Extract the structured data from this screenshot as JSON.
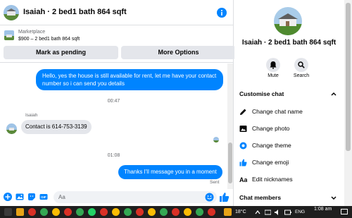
{
  "header": {
    "title": "Isaiah · 2 bed1 bath 864 sqft"
  },
  "listing": {
    "tag": "Marketplace",
    "summary": "$900 – 2 bed1 bath 864 sqft",
    "mark_pending_label": "Mark as pending",
    "more_options_label": "More Options"
  },
  "thread": {
    "messages": [
      {
        "from": "me",
        "text": "Hello, yes the house is still available for rent, let me have your contact number so i can send you details"
      },
      {
        "from": "Isaiah",
        "text": "Contact is 614-753-3139"
      },
      {
        "from": "me",
        "text": "Thanks I'll message you in a moment"
      }
    ],
    "timestamps": [
      "00:47",
      "01:08"
    ],
    "sender_name": "Isaiah",
    "sent_status": "Sent"
  },
  "composer": {
    "placeholder": "Aa"
  },
  "panel": {
    "title": "Isaiah · 2 bed1 bath 864 sqft",
    "mute_label": "Mute",
    "search_label": "Search",
    "customise_heading": "Customise chat",
    "options": [
      {
        "label": "Change chat name",
        "icon": "pencil-icon"
      },
      {
        "label": "Change photo",
        "icon": "photo-icon"
      },
      {
        "label": "Change theme",
        "icon": "theme-icon"
      },
      {
        "label": "Change emoji",
        "icon": "like-icon"
      },
      {
        "label": "Edit nicknames",
        "icon": "nickname-icon"
      }
    ],
    "members_heading": "Chat members"
  },
  "taskbar": {
    "temperature": "18°C",
    "language": "ENG",
    "time": "1:08 am"
  },
  "colors": {
    "accent": "#0084ff",
    "incoming_bubble": "#e4e6eb",
    "taskbar": "#1f1f1f"
  }
}
